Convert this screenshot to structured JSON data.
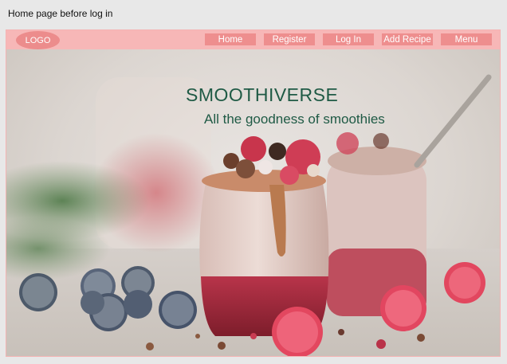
{
  "caption": "Home page before log in",
  "navbar": {
    "logo": "LOGO",
    "items": [
      {
        "label": "Home"
      },
      {
        "label": "Register"
      },
      {
        "label": "Log In"
      },
      {
        "label": "Add Recipe"
      },
      {
        "label": "Menu"
      }
    ]
  },
  "hero": {
    "title": "SMOOTHIVERSE",
    "subtitle": "All the goodness of smoothies"
  },
  "colors": {
    "navbar_bg": "#f7b7b7",
    "button_bg": "#ee8e8e",
    "title_text": "#1f5a45"
  }
}
